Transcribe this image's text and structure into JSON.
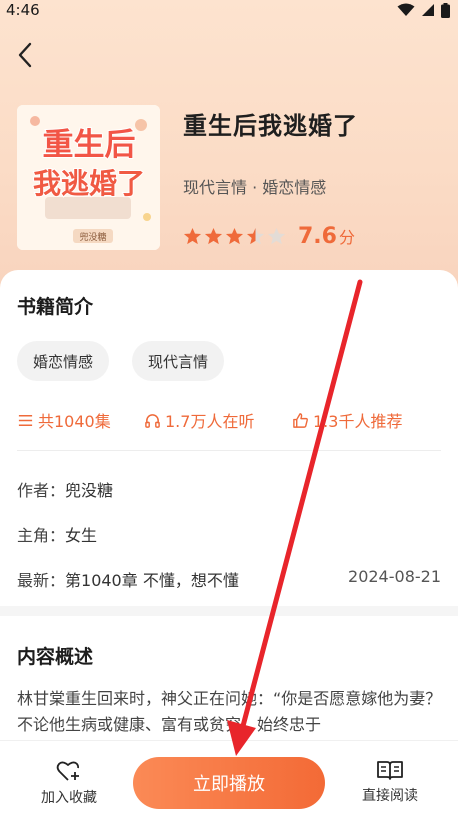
{
  "status_bar": {
    "time": "4:46"
  },
  "book": {
    "title": "重生后我逃婚了",
    "tags": "现代言情 · 婚恋情感",
    "rating": {
      "stars": 3.5,
      "max": 5,
      "score": "7.6",
      "unit": "分"
    },
    "cover_text": {
      "line1": "重生后",
      "line2": "我逃婚了",
      "author_tag": "兜没糖"
    }
  },
  "intro": {
    "title": "书籍简介",
    "chips": [
      "婚恋情感",
      "现代言情"
    ],
    "stats": {
      "episodes": "共1040集",
      "listeners": "1.7万人在听",
      "recommend": "1.3千人推荐"
    },
    "author_label": "作者：",
    "author": "兜没糖",
    "lead_label": "主角：",
    "lead": "女生",
    "latest_label": "最新：",
    "latest": "第1040章 不懂，想不懂",
    "latest_date": "2024-08-21"
  },
  "summary": {
    "title": "内容概述",
    "text": "林甘棠重生回来时，神父正在问她：“你是否愿意嫁他为妻？不论他生病或健康、富有或贫穷，始终忠于"
  },
  "bottom": {
    "favorite_label": "加入收藏",
    "play_label": "立即播放",
    "read_label": "直接阅读"
  },
  "colors": {
    "accent": "#ef6a3a",
    "hero_bg": "#fbdcc6",
    "annotation_arrow": "#e8252b"
  }
}
